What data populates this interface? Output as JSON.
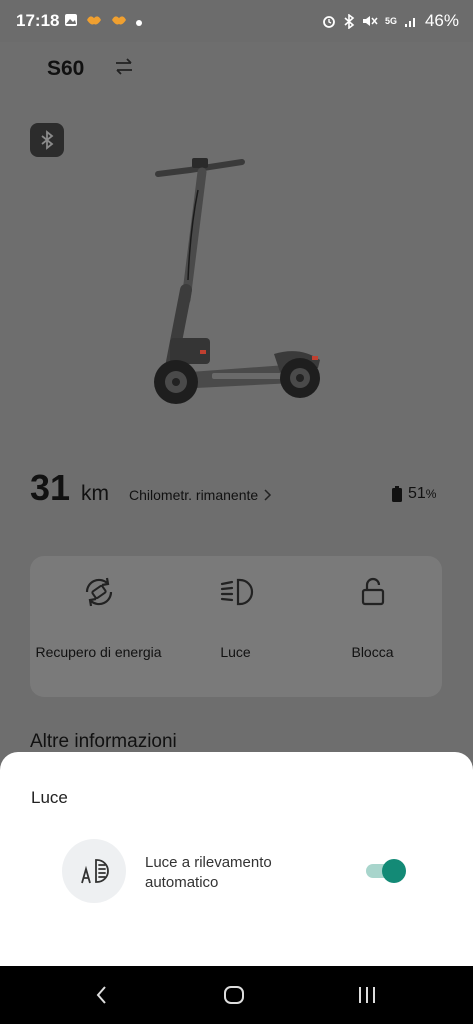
{
  "status_bar": {
    "time": "17:18",
    "battery_text": "46%",
    "network": "5G",
    "icons_left": [
      "gallery-icon",
      "app-notification-icon",
      "app-notification-icon",
      "dot-icon"
    ],
    "icons_right": [
      "alarm-icon",
      "bluetooth-icon",
      "mute-icon",
      "5g-icon",
      "signal-icon"
    ]
  },
  "header": {
    "device_name": "S60",
    "switch_icon": "swap-arrows-icon"
  },
  "range": {
    "value": "31",
    "unit": "km",
    "label": "Chilometr. rimanente",
    "battery_value": "51",
    "battery_unit": "%"
  },
  "controls": [
    {
      "label": "Recupero di energia",
      "icon": "energy-recovery-icon"
    },
    {
      "label": "Luce",
      "icon": "headlight-icon"
    },
    {
      "label": "Blocca",
      "icon": "unlock-icon"
    }
  ],
  "more_info": "Altre informazioni",
  "sheet": {
    "title": "Luce",
    "option_label": "Luce a rilevamento automatico",
    "option_icon": "auto-headlight-icon",
    "toggle_on": true,
    "accent_color": "#138a76"
  },
  "navbar": {
    "icons": [
      "back-icon",
      "home-icon",
      "recents-icon"
    ]
  }
}
